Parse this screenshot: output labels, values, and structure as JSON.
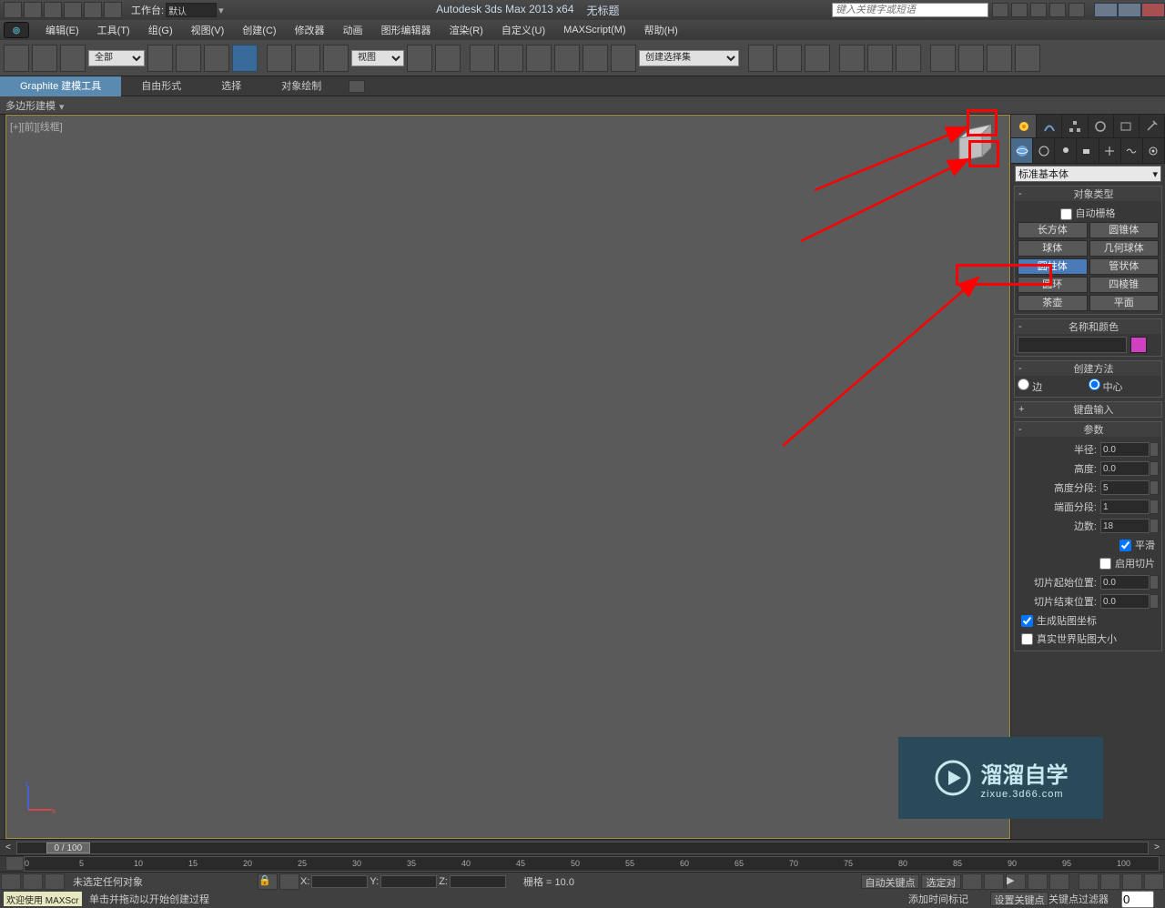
{
  "titlebar": {
    "workspace_label": "工作台:",
    "workspace_value": "默认",
    "app_title": "Autodesk 3ds Max  2013 x64",
    "doc_title": "无标题",
    "search_placeholder": "键入关键字或短语"
  },
  "menu": {
    "items": [
      "编辑(E)",
      "工具(T)",
      "组(G)",
      "视图(V)",
      "创建(C)",
      "修改器",
      "动画",
      "图形编辑器",
      "渲染(R)",
      "自定义(U)",
      "MAXScript(M)",
      "帮助(H)"
    ]
  },
  "toolbar": {
    "filter_all": "全部",
    "view_dd": "视图",
    "named_sel": "创建选择集"
  },
  "ribbon": {
    "tabs": [
      "Graphite 建模工具",
      "自由形式",
      "选择",
      "对象绘制"
    ],
    "active": 0,
    "subpanel": "多边形建模"
  },
  "viewport": {
    "label": "[+][前][线框]"
  },
  "command_panel": {
    "category": "标准基本体",
    "rollout_object_type": "对象类型",
    "auto_grid": "自动栅格",
    "buttons": [
      [
        "长方体",
        "圆锥体"
      ],
      [
        "球体",
        "几何球体"
      ],
      [
        "圆柱体",
        "管状体"
      ],
      [
        "圆环",
        "四棱锥"
      ],
      [
        "茶壶",
        "平面"
      ]
    ],
    "selected_button": "圆柱体",
    "rollout_name_color": "名称和颜色",
    "rollout_creation": "创建方法",
    "radio_edge": "边",
    "radio_center": "中心",
    "rollout_keyboard": "键盘输入",
    "rollout_params": "参数",
    "params": {
      "radius_label": "半径:",
      "radius_value": "0.0",
      "height_label": "高度:",
      "height_value": "0.0",
      "height_segs_label": "高度分段:",
      "height_segs_value": "5",
      "cap_segs_label": "端面分段:",
      "cap_segs_value": "1",
      "sides_label": "边数:",
      "sides_value": "18",
      "smooth": "平滑",
      "slice_on": "启用切片",
      "slice_from_label": "切片起始位置:",
      "slice_from_value": "0.0",
      "slice_to_label": "切片结束位置:",
      "slice_to_value": "0.0",
      "gen_mapping": "生成贴图坐标",
      "real_world": "真实世界贴图大小"
    }
  },
  "timeline": {
    "pos_label": "0 / 100",
    "ticks": [
      "0",
      "5",
      "10",
      "15",
      "20",
      "25",
      "30",
      "35",
      "40",
      "45",
      "50",
      "55",
      "60",
      "65",
      "70",
      "75",
      "80",
      "85",
      "90",
      "95",
      "100"
    ]
  },
  "status": {
    "no_selection": "未选定任何对象",
    "x_label": "X:",
    "y_label": "Y:",
    "z_label": "Z:",
    "grid": "栅格 = 10.0",
    "auto_key": "自动关键点",
    "selected_obj": "选定对",
    "welcome": "欢迎使用 MAXScr",
    "prompt": "单击并拖动以开始创建过程",
    "add_time_tag": "添加时间标记",
    "set_key": "设置关键点",
    "key_filters": "关键点过滤器"
  },
  "watermark": {
    "text1": "溜溜自学",
    "text2": "zixue.3d66.com"
  }
}
